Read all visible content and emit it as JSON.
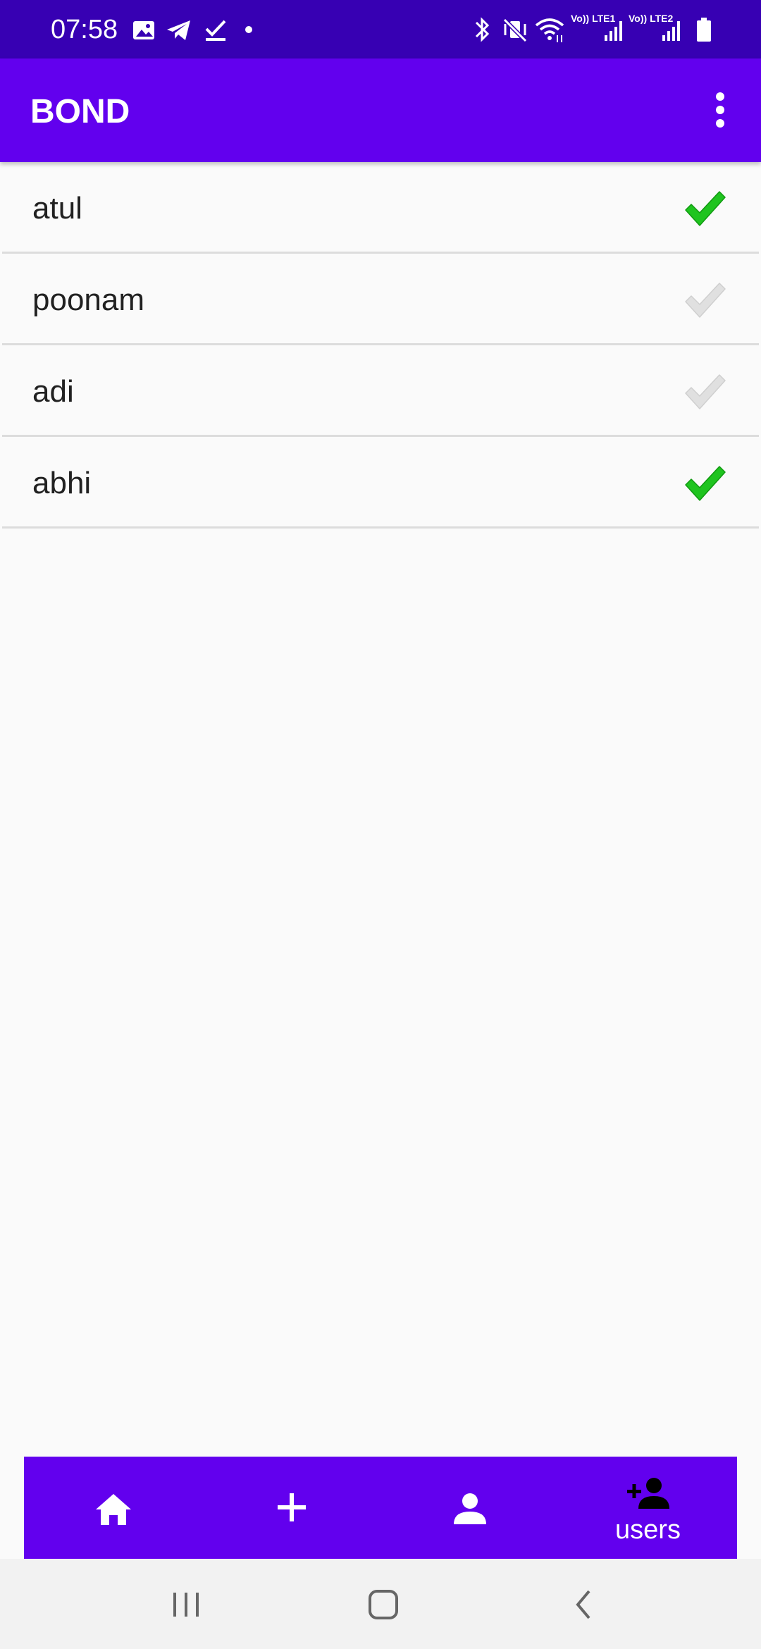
{
  "status_bar": {
    "time": "07:58",
    "colors": {
      "background": "#3700b3"
    },
    "left_icons": [
      "gallery-icon",
      "telegram-icon",
      "task-check-icon",
      "dot-icon"
    ],
    "right_icons": [
      "bluetooth-icon",
      "vibrate-mute-icon",
      "wifi-icon",
      "signal-sim1-icon",
      "signal-sim2-icon",
      "battery-icon"
    ],
    "sim1_label": "Vo)) LTE1",
    "sim2_label": "Vo)) LTE2"
  },
  "app_bar": {
    "title": "BOND",
    "menu_icon": "more-vert-icon",
    "colors": {
      "background": "#6200ee"
    }
  },
  "users": [
    {
      "name": "atul",
      "checked": true
    },
    {
      "name": "poonam",
      "checked": false
    },
    {
      "name": "adi",
      "checked": false
    },
    {
      "name": "abhi",
      "checked": true
    }
  ],
  "bottom_nav": {
    "items": [
      {
        "icon": "home-icon",
        "label": ""
      },
      {
        "icon": "plus-icon",
        "label": ""
      },
      {
        "icon": "person-icon",
        "label": ""
      },
      {
        "icon": "add-user-icon",
        "label": "users"
      }
    ],
    "colors": {
      "background": "#6200ee"
    }
  },
  "system_nav": {
    "buttons": [
      "recents-icon",
      "home-button-icon",
      "back-icon"
    ]
  },
  "colors": {
    "check_active": "#1fc41f",
    "check_inactive": "#e0e0e0"
  }
}
